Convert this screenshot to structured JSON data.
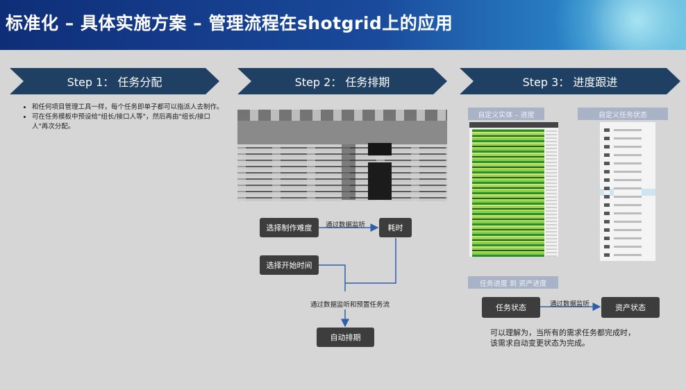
{
  "title": "标准化 – 具体实施方案 – 管理流程在shotgrid上的应用",
  "steps": [
    {
      "label": "Step 1：  任务分配"
    },
    {
      "label": "Step 2：  任务排期"
    },
    {
      "label": "Step 3：  进度跟进"
    }
  ],
  "step1": {
    "bullets": [
      "和任何项目管理工具一样，每个任务即单子都可以指派人去制作。",
      "可在任务模板中预设给\"组长/接口人等\"，然后再由\"组长/接口人\"再次分配。"
    ]
  },
  "step2": {
    "flow": {
      "select_difficulty": "选择制作难度",
      "monitor_label": "通过数据监听",
      "duration": "耗时",
      "select_start": "选择开始时间",
      "monitor_preset_label": "通过数据监听和预置任务流",
      "auto_schedule": "自动排期"
    }
  },
  "step3": {
    "custom_entity_progress": "自定义实体 – 进度",
    "custom_task_status": "自定义任务状态",
    "task_to_asset_progress": "任务进度 到 资产进度",
    "task_status": "任务状态",
    "monitor_label": "通过数据监听",
    "asset_status": "资产状态",
    "note_line1": "可以理解为，当所有的需求任务都完成时，",
    "note_line2": "该需求自动变更状态为完成。"
  },
  "colors": {
    "step_arrow": "#1f3f63",
    "flow_box": "#3d3d3d",
    "connector": "#2f5fa8",
    "pill": "#a9b3c7"
  }
}
